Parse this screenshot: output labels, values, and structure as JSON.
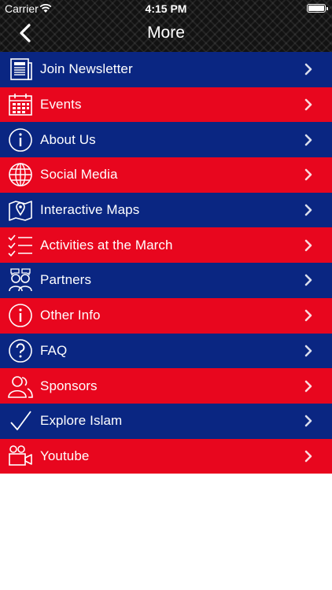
{
  "status_bar": {
    "carrier": "Carrier",
    "time": "4:15 PM"
  },
  "nav": {
    "title": "More"
  },
  "colors": {
    "blue": "#0a2682",
    "red": "#e8061e",
    "header": "#121212"
  },
  "menu": [
    {
      "label": "Join Newsletter",
      "icon": "newspaper-icon",
      "color": "blue"
    },
    {
      "label": "Events",
      "icon": "calendar-icon",
      "color": "red"
    },
    {
      "label": "About Us",
      "icon": "info-icon",
      "color": "blue"
    },
    {
      "label": "Social Media",
      "icon": "globe-icon",
      "color": "red"
    },
    {
      "label": "Interactive Maps",
      "icon": "map-pin-icon",
      "color": "blue"
    },
    {
      "label": "Activities at the March",
      "icon": "checklist-icon",
      "color": "red"
    },
    {
      "label": "Partners",
      "icon": "people-chat-icon",
      "color": "blue"
    },
    {
      "label": "Other Info",
      "icon": "info-icon",
      "color": "red"
    },
    {
      "label": "FAQ",
      "icon": "question-icon",
      "color": "blue"
    },
    {
      "label": "Sponsors",
      "icon": "people-icon",
      "color": "red"
    },
    {
      "label": "Explore Islam",
      "icon": "checkmark-icon",
      "color": "blue"
    },
    {
      "label": "Youtube",
      "icon": "video-camera-icon",
      "color": "red"
    }
  ]
}
